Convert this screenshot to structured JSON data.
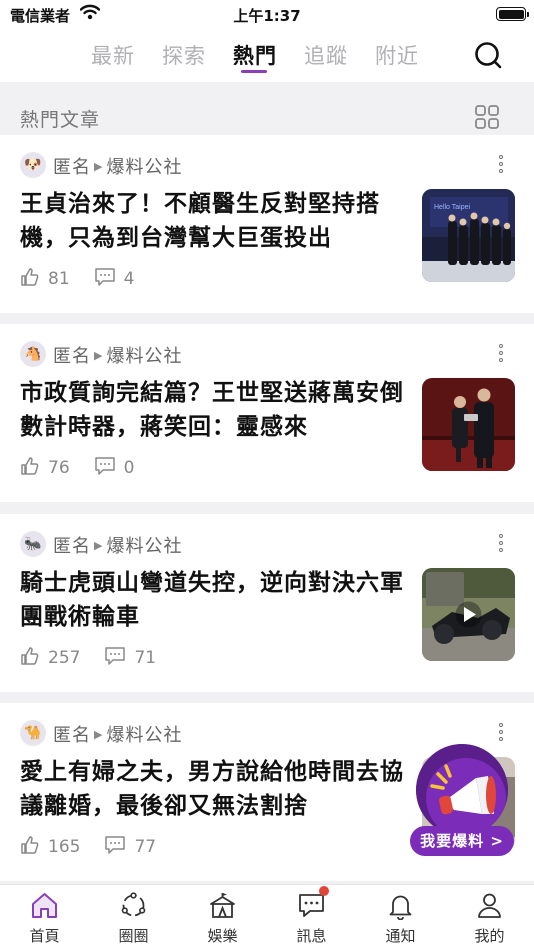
{
  "status_bar": {
    "carrier": "電信業者",
    "time": "上午1:37"
  },
  "top_tabs": [
    {
      "label": "最新"
    },
    {
      "label": "探索"
    },
    {
      "label": "熱門"
    },
    {
      "label": "追蹤"
    },
    {
      "label": "附近"
    }
  ],
  "active_tab": "熱門",
  "section": {
    "title": "熱門文章"
  },
  "posts": [
    {
      "author": "匿名",
      "board": "爆料公社",
      "avatar_emoji": "🐶",
      "title": "王貞治來了！不顧醫生反對堅持搭機，只為到台灣幫大巨蛋投出",
      "likes": "81",
      "comments": "4"
    },
    {
      "author": "匿名",
      "board": "爆料公社",
      "avatar_emoji": "🐴",
      "title": "市政質詢完結篇？王世堅送蔣萬安倒數計時器，蔣笑回：靈感來",
      "likes": "76",
      "comments": "0"
    },
    {
      "author": "匿名",
      "board": "爆料公社",
      "avatar_emoji": "🐜",
      "title": "騎士虎頭山彎道失控，逆向對決六軍團戰術輪車",
      "likes": "257",
      "comments": "71"
    },
    {
      "author": "匿名",
      "board": "爆料公社",
      "avatar_emoji": "🐪",
      "title": "愛上有婦之夫，男方說給他時間去協議離婚，最後卻又無法割捨",
      "likes": "165",
      "comments": "77"
    }
  ],
  "fab": {
    "label": "我要爆料 >"
  },
  "bottom_tabs": [
    {
      "label": "首頁",
      "icon": "home-icon"
    },
    {
      "label": "圈圈",
      "icon": "circle-arrows-icon"
    },
    {
      "label": "娛樂",
      "icon": "circus-tent-icon"
    },
    {
      "label": "訊息",
      "icon": "chat-bubble-icon"
    },
    {
      "label": "通知",
      "icon": "bell-icon"
    },
    {
      "label": "我的",
      "icon": "person-icon"
    }
  ],
  "colors": {
    "accent": "#8a3fb8",
    "badge": "#e0463a",
    "fab": "#7b2cb8"
  }
}
